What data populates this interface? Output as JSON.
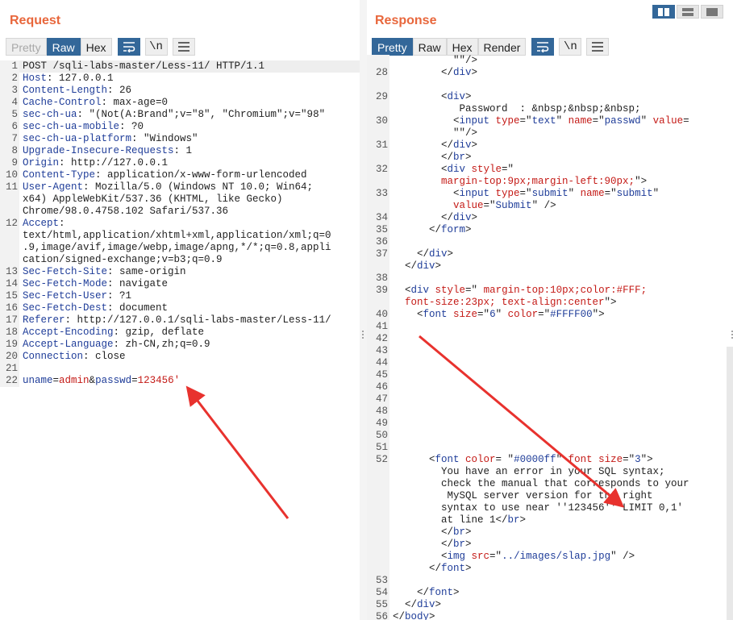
{
  "request": {
    "title": "Request",
    "tabs": [
      "Pretty",
      "Raw",
      "Hex"
    ],
    "lines": [
      {
        "n": "1",
        "parts": [
          [
            "",
            "POST /sqli-labs-master/Less-11/ HTTP/1.1"
          ]
        ]
      },
      {
        "n": "2",
        "parts": [
          [
            "k",
            "Host"
          ],
          [
            "",
            ": 127.0.0.1"
          ]
        ]
      },
      {
        "n": "3",
        "parts": [
          [
            "k",
            "Content-Length"
          ],
          [
            "",
            ": 26"
          ]
        ]
      },
      {
        "n": "4",
        "parts": [
          [
            "k",
            "Cache-Control"
          ],
          [
            "",
            ": max-age=0"
          ]
        ]
      },
      {
        "n": "5",
        "parts": [
          [
            "k",
            "sec-ch-ua"
          ],
          [
            "",
            ": \"(Not(A:Brand\";v=\"8\", \"Chromium\";v=\"98\""
          ]
        ]
      },
      {
        "n": "6",
        "parts": [
          [
            "k",
            "sec-ch-ua-mobile"
          ],
          [
            "",
            ": ?0"
          ]
        ]
      },
      {
        "n": "7",
        "parts": [
          [
            "k",
            "sec-ch-ua-platform"
          ],
          [
            "",
            ": \"Windows\""
          ]
        ]
      },
      {
        "n": "8",
        "parts": [
          [
            "k",
            "Upgrade-Insecure-Requests"
          ],
          [
            "",
            ": 1"
          ]
        ]
      },
      {
        "n": "9",
        "parts": [
          [
            "k",
            "Origin"
          ],
          [
            "",
            ": http://127.0.0.1"
          ]
        ]
      },
      {
        "n": "10",
        "parts": [
          [
            "k",
            "Content-Type"
          ],
          [
            "",
            ": application/x-www-form-urlencoded"
          ]
        ]
      },
      {
        "n": "11",
        "parts": [
          [
            "k",
            "User-Agent"
          ],
          [
            "",
            ": Mozilla/5.0 (Windows NT 10.0; Win64;"
          ]
        ]
      },
      {
        "n": "",
        "parts": [
          [
            "",
            "x64) AppleWebKit/537.36 (KHTML, like Gecko)"
          ]
        ]
      },
      {
        "n": "",
        "parts": [
          [
            "",
            "Chrome/98.0.4758.102 Safari/537.36"
          ]
        ]
      },
      {
        "n": "12",
        "parts": [
          [
            "k",
            "Accept"
          ],
          [
            "",
            ":"
          ]
        ]
      },
      {
        "n": "",
        "parts": [
          [
            "",
            "text/html,application/xhtml+xml,application/xml;q=0"
          ]
        ]
      },
      {
        "n": "",
        "parts": [
          [
            "",
            ".9,image/avif,image/webp,image/apng,*/*;q=0.8,appli"
          ]
        ]
      },
      {
        "n": "",
        "parts": [
          [
            "",
            "cation/signed-exchange;v=b3;q=0.9"
          ]
        ]
      },
      {
        "n": "13",
        "parts": [
          [
            "k",
            "Sec-Fetch-Site"
          ],
          [
            "",
            ": same-origin"
          ]
        ]
      },
      {
        "n": "14",
        "parts": [
          [
            "k",
            "Sec-Fetch-Mode"
          ],
          [
            "",
            ": navigate"
          ]
        ]
      },
      {
        "n": "15",
        "parts": [
          [
            "k",
            "Sec-Fetch-User"
          ],
          [
            "",
            ": ?1"
          ]
        ]
      },
      {
        "n": "16",
        "parts": [
          [
            "k",
            "Sec-Fetch-Dest"
          ],
          [
            "",
            ": document"
          ]
        ]
      },
      {
        "n": "17",
        "parts": [
          [
            "k",
            "Referer"
          ],
          [
            "",
            ": http://127.0.0.1/sqli-labs-master/Less-11/"
          ]
        ]
      },
      {
        "n": "18",
        "parts": [
          [
            "k",
            "Accept-Encoding"
          ],
          [
            "",
            ": gzip, deflate"
          ]
        ]
      },
      {
        "n": "19",
        "parts": [
          [
            "k",
            "Accept-Language"
          ],
          [
            "",
            ": zh-CN,zh;q=0.9"
          ]
        ]
      },
      {
        "n": "20",
        "parts": [
          [
            "k",
            "Connection"
          ],
          [
            "",
            ": close"
          ]
        ]
      },
      {
        "n": "21",
        "parts": [
          [
            "",
            ""
          ]
        ]
      },
      {
        "n": "22",
        "parts": [
          [
            "k",
            "uname"
          ],
          [
            "",
            "="
          ],
          [
            "v",
            "admin"
          ],
          [
            "",
            "&"
          ],
          [
            "k",
            "passwd"
          ],
          [
            "",
            "="
          ],
          [
            "v",
            "123456'"
          ]
        ]
      }
    ]
  },
  "response": {
    "title": "Response",
    "tabs": [
      "Pretty",
      "Raw",
      "Hex",
      "Render"
    ],
    "lines": [
      {
        "n": "",
        "parts": [
          [
            "",
            "          \"\"/>"
          ]
        ]
      },
      {
        "n": "28",
        "parts": [
          [
            "",
            "        </"
          ],
          [
            "t",
            "div"
          ],
          [
            "",
            ">"
          ]
        ]
      },
      {
        "n": "",
        "parts": [
          [
            "",
            ""
          ]
        ]
      },
      {
        "n": "29",
        "parts": [
          [
            "",
            "        <"
          ],
          [
            "t",
            "div"
          ],
          [
            "",
            ">"
          ]
        ]
      },
      {
        "n": "",
        "parts": [
          [
            "",
            "           Password  : &nbsp;&nbsp;&nbsp;"
          ]
        ]
      },
      {
        "n": "30",
        "parts": [
          [
            "",
            "          <"
          ],
          [
            "t",
            "input"
          ],
          [
            "a",
            " type"
          ],
          [
            "",
            "=\""
          ],
          [
            "t",
            "text"
          ],
          [
            "",
            "\""
          ],
          [
            "a",
            " name"
          ],
          [
            "",
            "=\""
          ],
          [
            "t",
            "passwd"
          ],
          [
            "",
            "\""
          ],
          [
            "a",
            " value"
          ],
          [
            "",
            "="
          ]
        ]
      },
      {
        "n": "",
        "parts": [
          [
            "",
            "          \"\"/>"
          ]
        ]
      },
      {
        "n": "31",
        "parts": [
          [
            "",
            "        </"
          ],
          [
            "t",
            "div"
          ],
          [
            "",
            ">"
          ]
        ]
      },
      {
        "n": "",
        "parts": [
          [
            "",
            "        </"
          ],
          [
            "t",
            "br"
          ],
          [
            "",
            ">"
          ]
        ]
      },
      {
        "n": "32",
        "parts": [
          [
            "",
            "        <"
          ],
          [
            "t",
            "div"
          ],
          [
            "a",
            " style"
          ],
          [
            "",
            "=\""
          ]
        ]
      },
      {
        "n": "",
        "parts": [
          [
            "a",
            "        margin-top:9px;margin-left:90px;"
          ],
          [
            "",
            "\">"
          ]
        ]
      },
      {
        "n": "33",
        "parts": [
          [
            "",
            "          <"
          ],
          [
            "t",
            "input"
          ],
          [
            "a",
            " type"
          ],
          [
            "",
            "=\""
          ],
          [
            "t",
            "submit"
          ],
          [
            "",
            "\""
          ],
          [
            "a",
            " name"
          ],
          [
            "",
            "=\""
          ],
          [
            "t",
            "submit"
          ],
          [
            "",
            "\""
          ]
        ]
      },
      {
        "n": "",
        "parts": [
          [
            "a",
            "          value"
          ],
          [
            "",
            "=\""
          ],
          [
            "t",
            "Submit"
          ],
          [
            "",
            "\" />"
          ]
        ]
      },
      {
        "n": "34",
        "parts": [
          [
            "",
            "        </"
          ],
          [
            "t",
            "div"
          ],
          [
            "",
            ">"
          ]
        ]
      },
      {
        "n": "35",
        "parts": [
          [
            "",
            "      </"
          ],
          [
            "t",
            "form"
          ],
          [
            "",
            ">"
          ]
        ]
      },
      {
        "n": "36",
        "parts": [
          [
            "",
            ""
          ]
        ]
      },
      {
        "n": "37",
        "parts": [
          [
            "",
            "    </"
          ],
          [
            "t",
            "div"
          ],
          [
            "",
            ">"
          ]
        ]
      },
      {
        "n": "",
        "parts": [
          [
            "",
            "  </"
          ],
          [
            "t",
            "div"
          ],
          [
            "",
            ">"
          ]
        ]
      },
      {
        "n": "38",
        "parts": [
          [
            "",
            ""
          ]
        ]
      },
      {
        "n": "39",
        "parts": [
          [
            "",
            "  <"
          ],
          [
            "t",
            "div"
          ],
          [
            "a",
            " style"
          ],
          [
            "",
            "=\""
          ],
          [
            "a",
            " margin-top:10px;color:#FFF;"
          ]
        ]
      },
      {
        "n": "",
        "parts": [
          [
            "a",
            "  font-size:23px; text-align:center"
          ],
          [
            "",
            "\">"
          ]
        ]
      },
      {
        "n": "40",
        "parts": [
          [
            "",
            "    <"
          ],
          [
            "t",
            "font"
          ],
          [
            "a",
            " size"
          ],
          [
            "",
            "=\""
          ],
          [
            "t",
            "6"
          ],
          [
            "",
            "\""
          ],
          [
            "a",
            " color"
          ],
          [
            "",
            "=\""
          ],
          [
            "t",
            "#FFFF00"
          ],
          [
            "",
            "\">"
          ]
        ]
      },
      {
        "n": "41",
        "parts": [
          [
            "",
            ""
          ]
        ]
      },
      {
        "n": "42",
        "parts": [
          [
            "",
            ""
          ]
        ]
      },
      {
        "n": "43",
        "parts": [
          [
            "",
            ""
          ]
        ]
      },
      {
        "n": "44",
        "parts": [
          [
            "",
            ""
          ]
        ]
      },
      {
        "n": "45",
        "parts": [
          [
            "",
            ""
          ]
        ]
      },
      {
        "n": "46",
        "parts": [
          [
            "",
            ""
          ]
        ]
      },
      {
        "n": "47",
        "parts": [
          [
            "",
            ""
          ]
        ]
      },
      {
        "n": "48",
        "parts": [
          [
            "",
            ""
          ]
        ]
      },
      {
        "n": "49",
        "parts": [
          [
            "",
            ""
          ]
        ]
      },
      {
        "n": "50",
        "parts": [
          [
            "",
            ""
          ]
        ]
      },
      {
        "n": "51",
        "parts": [
          [
            "",
            ""
          ]
        ]
      },
      {
        "n": "52",
        "parts": [
          [
            "",
            "      <"
          ],
          [
            "t",
            "font"
          ],
          [
            "a",
            " color"
          ],
          [
            "",
            "= \""
          ],
          [
            "t",
            "#0000ff"
          ],
          [
            "",
            "\""
          ],
          [
            "a",
            " font size"
          ],
          [
            "",
            "=\""
          ],
          [
            "t",
            "3"
          ],
          [
            "",
            "\">"
          ]
        ]
      },
      {
        "n": "",
        "parts": [
          [
            "",
            "        You have an error in your SQL syntax;"
          ]
        ]
      },
      {
        "n": "",
        "parts": [
          [
            "",
            "        check the manual that corresponds to your"
          ]
        ]
      },
      {
        "n": "",
        "parts": [
          [
            "",
            "         MySQL server version for the right"
          ]
        ]
      },
      {
        "n": "",
        "parts": [
          [
            "",
            "        syntax to use near ''123456'' LIMIT 0,1'"
          ]
        ]
      },
      {
        "n": "",
        "parts": [
          [
            "",
            "        at line 1</"
          ],
          [
            "t",
            "br"
          ],
          [
            "",
            ">"
          ]
        ]
      },
      {
        "n": "",
        "parts": [
          [
            "",
            "        </"
          ],
          [
            "t",
            "br"
          ],
          [
            "",
            ">"
          ]
        ]
      },
      {
        "n": "",
        "parts": [
          [
            "",
            "        </"
          ],
          [
            "t",
            "br"
          ],
          [
            "",
            ">"
          ]
        ]
      },
      {
        "n": "",
        "parts": [
          [
            "",
            "        <"
          ],
          [
            "t",
            "img"
          ],
          [
            "a",
            " src"
          ],
          [
            "",
            "=\""
          ],
          [
            "t",
            "../images/slap.jpg"
          ],
          [
            "",
            "\" />"
          ]
        ]
      },
      {
        "n": "",
        "parts": [
          [
            "",
            "      </"
          ],
          [
            "t",
            "font"
          ],
          [
            "",
            ">"
          ]
        ]
      },
      {
        "n": "53",
        "parts": [
          [
            "",
            ""
          ]
        ]
      },
      {
        "n": "54",
        "parts": [
          [
            "",
            "    </"
          ],
          [
            "t",
            "font"
          ],
          [
            "",
            ">"
          ]
        ]
      },
      {
        "n": "55",
        "parts": [
          [
            "",
            "  </"
          ],
          [
            "t",
            "div"
          ],
          [
            "",
            ">"
          ]
        ]
      },
      {
        "n": "56",
        "parts": [
          [
            "",
            "</"
          ],
          [
            "t",
            "body"
          ],
          [
            "",
            ">"
          ]
        ]
      }
    ]
  },
  "colors": {
    "accent": "#e8673c",
    "active_tab": "#336799",
    "arrow": "#e8322e"
  },
  "icons": {
    "wrap": "wrap-lines-icon",
    "newline": "newline-icon",
    "menu": "menu-icon"
  }
}
